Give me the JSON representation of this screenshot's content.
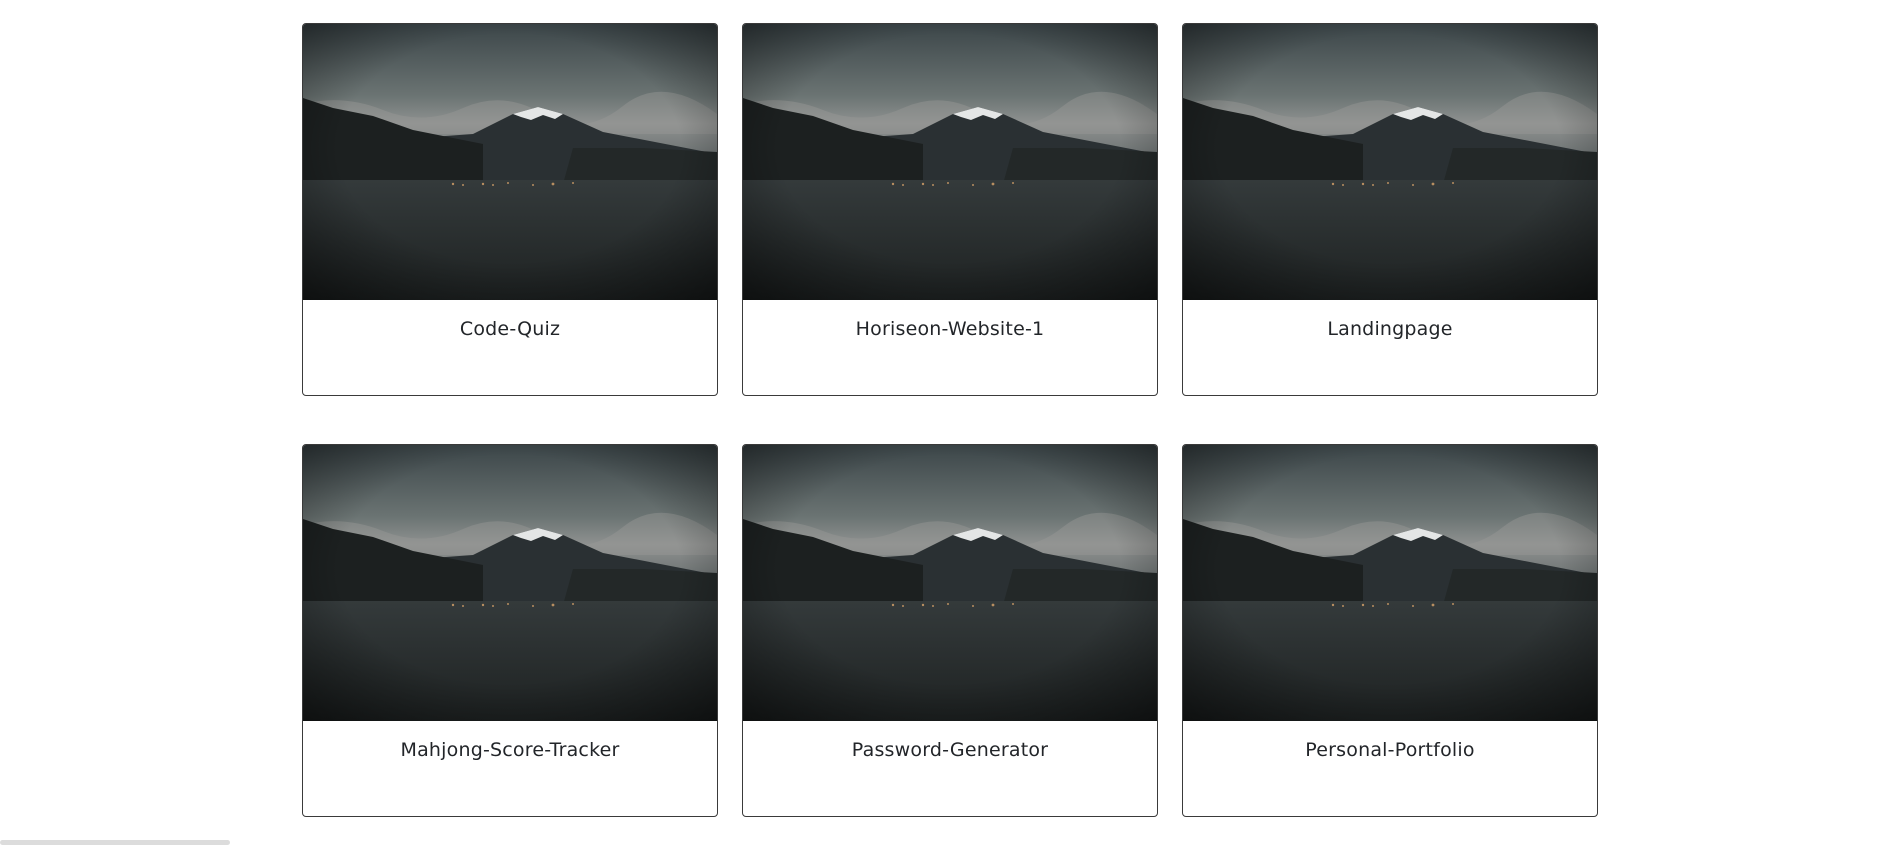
{
  "projects": [
    {
      "title": "Code-Quiz",
      "image": "mountain-lake-photo"
    },
    {
      "title": "Horiseon-Website-1",
      "image": "mountain-lake-photo"
    },
    {
      "title": "Landingpage",
      "image": "mountain-lake-photo"
    },
    {
      "title": "Mahjong-Score-Tracker",
      "image": "mountain-lake-photo"
    },
    {
      "title": "Password-Generator",
      "image": "mountain-lake-photo"
    },
    {
      "title": "Personal-Portfolio",
      "image": "mountain-lake-photo"
    }
  ]
}
